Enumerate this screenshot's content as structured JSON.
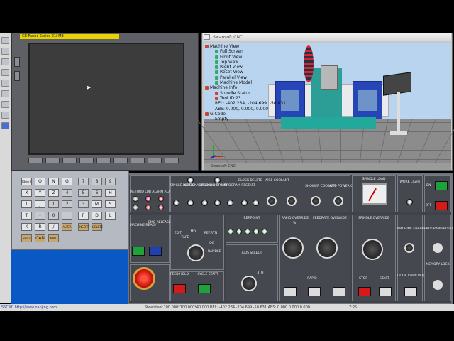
{
  "cnc": {
    "brand": "GE Fanuc    Series 21i MB"
  },
  "keypad": {
    "keys": [
      "RESET",
      "O",
      "N",
      "G",
      "7",
      "8",
      "9",
      "X",
      "Y",
      "Z",
      "4",
      "5",
      "6",
      "H",
      "I",
      "J",
      "1",
      "2",
      "3",
      "M",
      "S",
      "T",
      "-",
      "0",
      ".",
      "F",
      "D",
      "L",
      "K",
      "R",
      "/",
      "ALTER",
      "INSERT",
      "DELETE",
      "SHIFT",
      "CAN",
      "INPUT"
    ]
  },
  "view3d": {
    "title": "Swansoft CNC",
    "footer": "Swansoft CNC",
    "tree": [
      {
        "label": "Machine View",
        "indent": 0,
        "icon": "#c43"
      },
      {
        "label": "Full Screen",
        "indent": 1,
        "icon": "#3a6"
      },
      {
        "label": "Front View",
        "indent": 1,
        "icon": "#3a6"
      },
      {
        "label": "Top View",
        "indent": 1,
        "icon": "#3a6"
      },
      {
        "label": "Right View",
        "indent": 1,
        "icon": "#3a6"
      },
      {
        "label": "Reset View",
        "indent": 1,
        "icon": "#3a6"
      },
      {
        "label": "Parallel View",
        "indent": 1,
        "icon": "#3a6"
      },
      {
        "label": "Machine Model",
        "indent": 1,
        "icon": "#3a6"
      },
      {
        "label": "Machine Info",
        "indent": 0,
        "icon": "#c43"
      },
      {
        "label": "Spindle Status",
        "indent": 1,
        "icon": "#c43"
      },
      {
        "label": "Tool ID:23",
        "indent": 1,
        "icon": "#c43"
      },
      {
        "label": "REL:  -402.234,  -204.699,  -50.631",
        "indent": 1,
        "icon": ""
      },
      {
        "label": "ABS:     0.000,     0.000,    0.000",
        "indent": 1,
        "icon": ""
      },
      {
        "label": "G Code",
        "indent": 0,
        "icon": "#c43"
      },
      {
        "label": "Empty",
        "indent": 1,
        "icon": ""
      }
    ]
  },
  "panel": {
    "labels": {
      "method": "METHOD LUB ALARM ALARM",
      "single": "SINGLE BLOCK",
      "optional": "OPTIONAL BLOCK",
      "optstop": "OPTIONAL STOP",
      "dryrun": "DRY RUN",
      "program": "PROGRAM RESTART",
      "block": "BLOCK DELETE",
      "aire": "AIRE COOLANT",
      "mistcool": "SHOWER COOLANT",
      "autoref": "AUTO POWER OFF",
      "spindle_load": "SPINDLE LOAD",
      "work_light": "WORK LIGHT",
      "on": "ON",
      "off": "OFF",
      "machine_ready": "MACHINE READY",
      "emg_release": "EMG RELEASE ALARM RESET",
      "ref_point": "REF.POINT",
      "rapid_override": "RAPID OVERRIDE",
      "feedrate_override": "FEEDRATE OVERRIDE",
      "spindle_override": "SPINDLE OVERRIDE",
      "axis_select": "AXIS SELECT",
      "feed_hold": "FEED HOLD",
      "cycle_start": "CYCLE START",
      "rapid": "RAPID",
      "stop": "STOP",
      "start": "START",
      "door_open": "DOOR OPEN REQUEST",
      "machine_enable": "MACHINE ENABLE",
      "program_protect": "PROGRAM PROTECT",
      "memory_lock": "MEMORY LOCK",
      "edit": "EDIT",
      "mode_tape": "TAPE",
      "mode_mdi": "MDI",
      "mode_ref": "REF.RTN",
      "mode_jog": "JOG",
      "mode_handle": "HANDLE",
      "rapid_pct": "%",
      "axis_4th": "4TH"
    }
  },
  "statusbar": {
    "left": "SSCNC http://www.nanjing.com",
    "coords": "Steelsteel:100.000*100.000*40.000     REL: -402.234  -204.699  -50.631     ABS:    0.000     0.000     0.000",
    "time": "7:25"
  }
}
